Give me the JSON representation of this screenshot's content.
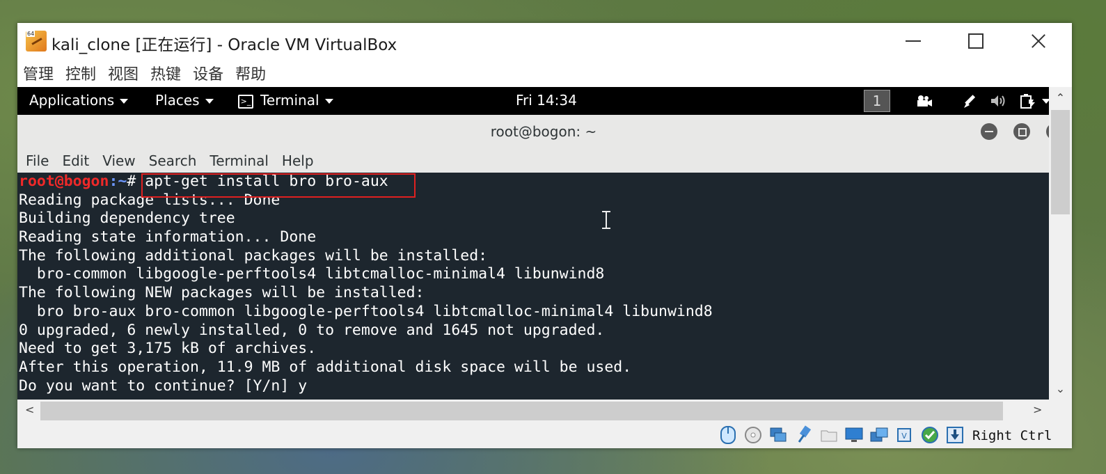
{
  "window": {
    "title": "kali_clone [正在运行] - Oracle VM VirtualBox",
    "icon_badge": "64"
  },
  "vbox_menu": [
    "管理",
    "控制",
    "视图",
    "热键",
    "设备",
    "帮助"
  ],
  "gnome_panel": {
    "applications": "Applications",
    "places": "Places",
    "terminal": "Terminal",
    "clock": "Fri 14:34",
    "workspace": "1"
  },
  "terminal": {
    "title": "root@bogon: ~",
    "menu": [
      "File",
      "Edit",
      "View",
      "Search",
      "Terminal",
      "Help"
    ],
    "prompt_user": "root@bogon",
    "prompt_path": ":~",
    "prompt_symbol": "# ",
    "command": "apt-get install bro bro-aux",
    "output": [
      "Reading package lists... Done",
      "Building dependency tree",
      "Reading state information... Done",
      "The following additional packages will be installed:",
      "  bro-common libgoogle-perftools4 libtcmalloc-minimal4 libunwind8",
      "The following NEW packages will be installed:",
      "  bro bro-aux bro-common libgoogle-perftools4 libtcmalloc-minimal4 libunwind8",
      "0 upgraded, 6 newly installed, 0 to remove and 1645 not upgraded.",
      "Need to get 3,175 kB of archives.",
      "After this operation, 11.9 MB of additional disk space will be used.",
      "Do you want to continue? [Y/n] y"
    ]
  },
  "status_bar": {
    "host_key": "Right Ctrl",
    "icons": [
      "mouse-integration-icon",
      "optical-drive-icon",
      "network-icon",
      "usb-icon",
      "shared-folder-icon",
      "display-icon",
      "snapshot-icon",
      "cpu-icon",
      "guest-additions-icon",
      "capture-icon"
    ]
  },
  "colors": {
    "terminal_bg": "#1d262e",
    "prompt_user": "#ef2929",
    "prompt_path": "#6d97ff",
    "highlight_box": "#e02020"
  }
}
